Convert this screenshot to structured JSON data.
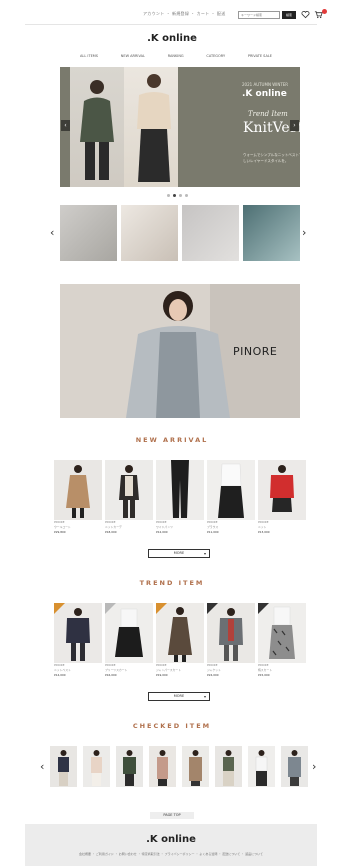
{
  "header": {
    "links": "アカウント ・ 新規登録 ・ カート ・ 配送",
    "search_placeholder": "キーワード検索",
    "search_button": "検索"
  },
  "logo": ".K online",
  "nav": [
    "ALL ITEMS",
    "NEW ARRIVAL",
    "RANKING",
    "CATEGORY",
    "PRIVATE SALE"
  ],
  "hero": {
    "tag": "2021 AUTUMN WINTER",
    "brand": ".K online",
    "script": "Trend Item",
    "title": "KnitVest",
    "copy": "ウォームでシンプルなニットベストで、今季らしいレイヤードスタイルを。",
    "prev": "‹",
    "next": "›"
  },
  "banner": {
    "word": "PINORE"
  },
  "sections": {
    "new_arrival": "NEW ARRIVAL",
    "trend_item": "TREND ITEM",
    "checked_item": "CHECKED ITEM"
  },
  "new_arrival": [
    {
      "brand": "PINORE",
      "name": "ウールコート",
      "price": "¥29,800"
    },
    {
      "brand": "PINORE",
      "name": "ニットカーデ",
      "price": "¥18,000"
    },
    {
      "brand": "PINORE",
      "name": "ワイドパンツ",
      "price": "¥12,000"
    },
    {
      "brand": "PINORE",
      "name": "ブラウス",
      "price": "¥11,000"
    },
    {
      "brand": "PINORE",
      "name": "ニット",
      "price": "¥13,000"
    }
  ],
  "trend_item": [
    {
      "brand": "PINORE",
      "name": "ニットベスト",
      "price": "¥14,000"
    },
    {
      "brand": "PINORE",
      "name": "プリーツスカート",
      "price": "¥16,000"
    },
    {
      "brand": "PINORE",
      "name": "ジャンパースカート",
      "price": "¥19,000"
    },
    {
      "brand": "PINORE",
      "name": "ジャケット",
      "price": "¥24,000"
    },
    {
      "brand": "PINORE",
      "name": "柄スカート",
      "price": "¥15,000"
    }
  ],
  "more_label": "MORE",
  "pagetop": "PAGE TOP",
  "footer": {
    "logo": ".K online",
    "links": "会社概要 ・ ご利用ガイド ・ お問い合わせ ・ 特定商取引法 ・ プライバシーポリシー ・ よくある質問 ・ 配送について ・ 返品について"
  },
  "colors": {
    "accent": "#b0704c",
    "hero_bg": "#7a7a6d",
    "cart_badge": "#e23b3b"
  }
}
